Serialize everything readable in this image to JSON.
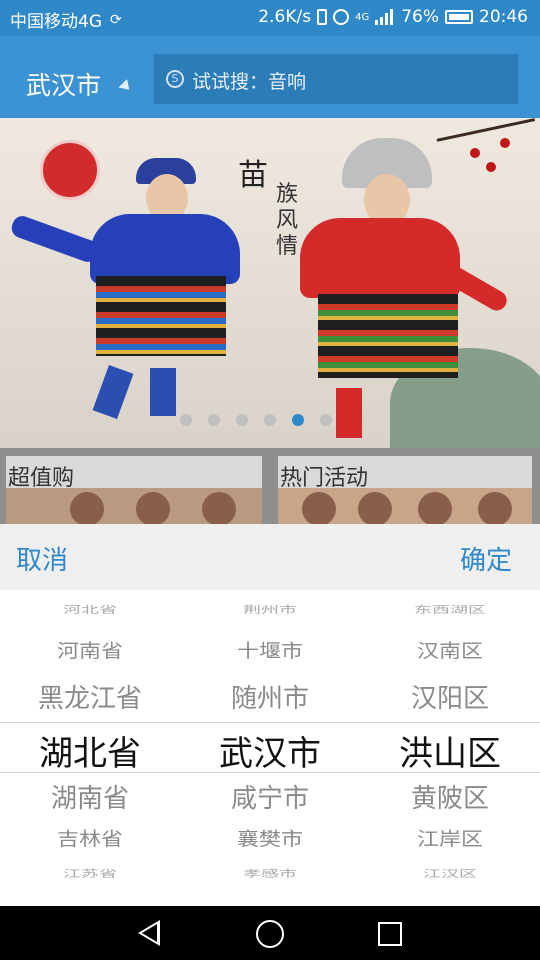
{
  "status_bar": {
    "carrier": "中国移动4G",
    "speed": "2.6K/s",
    "network": "4G",
    "battery": "76%",
    "time": "20:46"
  },
  "header": {
    "city": "武汉市",
    "search_placeholder": "试试搜：音响",
    "search_icon_glyph": "S"
  },
  "banner": {
    "title": "苗",
    "subtitle": "族风情",
    "slide_count": 6,
    "active_slide": 4
  },
  "tiles": [
    {
      "label": "超值购"
    },
    {
      "label": "热门活动"
    }
  ],
  "picker": {
    "cancel_label": "取消",
    "confirm_label": "确定",
    "provinces": [
      "河北省",
      "河南省",
      "黑龙江省",
      "湖北省",
      "湖南省",
      "吉林省",
      "江苏省"
    ],
    "cities": [
      "荆州市",
      "十堰市",
      "随州市",
      "武汉市",
      "咸宁市",
      "襄樊市",
      "孝感市"
    ],
    "districts": [
      "东西湖区",
      "汉南区",
      "汉阳区",
      "洪山区",
      "黄陂区",
      "江岸区",
      "江汉区"
    ],
    "selected": {
      "province": "湖北省",
      "city": "武汉市",
      "district": "洪山区"
    }
  },
  "colors": {
    "accent": "#2f88c8",
    "header": "#3b93d3"
  },
  "icons": [
    "vibrate-icon",
    "alarm-icon",
    "signal-icon",
    "battery-icon",
    "search-icon",
    "dropdown-caret-icon",
    "back-icon",
    "home-icon",
    "recent-apps-icon"
  ]
}
